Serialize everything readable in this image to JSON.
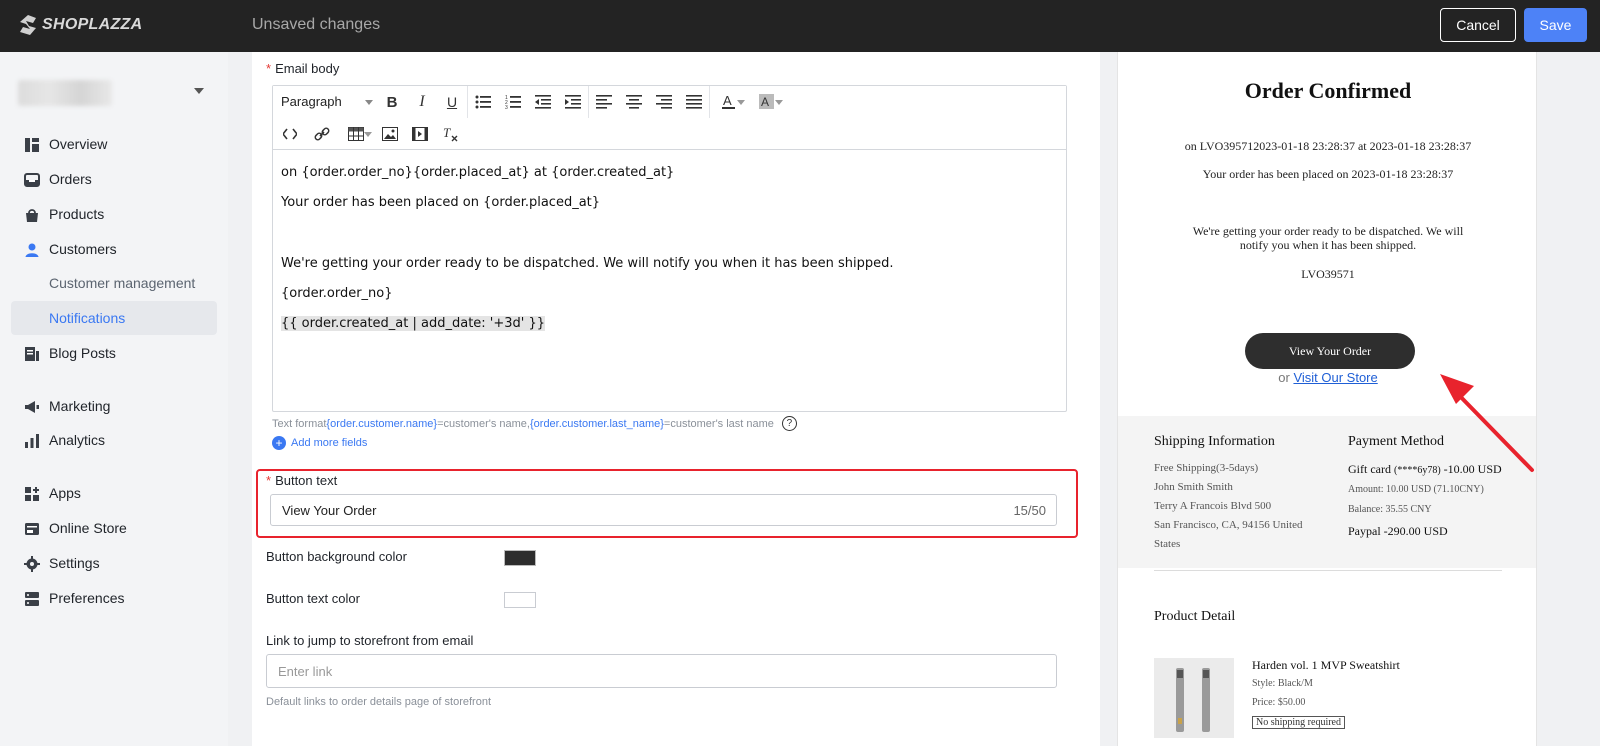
{
  "topbar": {
    "logo_text": "SHOPLAZZA",
    "status": "Unsaved changes",
    "cancel_label": "Cancel",
    "save_label": "Save"
  },
  "sidebar": {
    "items": [
      {
        "label": "Overview",
        "icon": "overview-icon"
      },
      {
        "label": "Orders",
        "icon": "orders-icon"
      },
      {
        "label": "Products",
        "icon": "products-icon"
      },
      {
        "label": "Customers",
        "icon": "customers-icon"
      },
      {
        "label": "Customer management",
        "icon": ""
      },
      {
        "label": "Notifications",
        "icon": ""
      },
      {
        "label": "Blog Posts",
        "icon": "blog-posts-icon"
      },
      {
        "label": "Marketing",
        "icon": "marketing-icon"
      },
      {
        "label": "Analytics",
        "icon": "analytics-icon"
      },
      {
        "label": "Apps",
        "icon": "apps-icon"
      },
      {
        "label": "Online Store",
        "icon": "online-store-icon"
      },
      {
        "label": "Settings",
        "icon": "settings-icon"
      },
      {
        "label": "Preferences",
        "icon": "preferences-icon"
      }
    ],
    "active": "Notifications",
    "accent_color": "#3a78f2"
  },
  "form": {
    "email_body_label": "Email body",
    "toolbar": {
      "paragraph": "Paragraph"
    },
    "body_lines": [
      "on {order.order_no}{order.placed_at} at {order.created_at}",
      "Your order has been placed on {order.placed_at}",
      "We're getting your order ready to be dispatched. We will notify you when it has been shipped.",
      "{order.order_no}",
      "{{ order.created_at | add_date: '+3d' }}"
    ],
    "hint": {
      "prefix": "Text format",
      "field1": "{order.customer.name}",
      "mid": "=customer's name, ",
      "field2": "{order.customer.last_name}",
      "suffix": "=customer's last name"
    },
    "add_more_fields": "Add more fields",
    "button_text_label": "Button text",
    "button_text_value": "View Your Order",
    "button_text_count": "15/50",
    "bg_color_label": "Button background color",
    "bg_color": "#2d2d2d",
    "text_color_label": "Button text color",
    "text_color": "#ffffff",
    "link_label": "Link to jump to storefront from email",
    "link_placeholder": "Enter link",
    "link_hint": "Default links to order details page of storefront"
  },
  "preview": {
    "title": "Order Confirmed",
    "line1": "on LVO395712023-01-18 23:28:37 at 2023-01-18 23:28:37",
    "line2": "Your order has been placed on 2023-01-18 23:28:37",
    "line3a": "We're getting your order ready to be dispatched. We will",
    "line3b": "notify you when it has been shipped.",
    "order_no": "LVO39571",
    "button": "View Your Order",
    "or": "or",
    "visit_store": "Visit Our Store",
    "shipping": {
      "heading": "Shipping Information",
      "lines": [
        "Free Shipping(3-5days)",
        "John Smith Smith",
        "Terry A Francois Blvd 500",
        "San Francisco, CA, 94156 United",
        "States"
      ]
    },
    "payment": {
      "heading": "Payment Method",
      "gift_card": "Gift card",
      "gift_card_no": "(****6y78)",
      "gift_card_amount": "-10.00 USD",
      "amount": "Amount:  10.00 USD  (71.10CNY)",
      "balance": "Balance:  35.55 CNY",
      "paypal": "Paypal",
      "paypal_amount": "-290.00 USD"
    },
    "product_detail": "Product Detail",
    "product": {
      "name": "Harden vol. 1 MVP Sweatshirt",
      "style": "Style: Black/M",
      "price": "Price: $50.00",
      "tag": "No shipping required"
    }
  },
  "annotation_color": "#e8232d"
}
